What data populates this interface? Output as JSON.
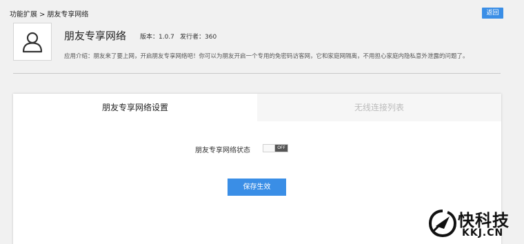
{
  "breadcrumb": {
    "parent": "功能扩展",
    "separator": ">",
    "current": "朋友专享网络"
  },
  "back_button": "返回",
  "app": {
    "icon": "user-silhouette-icon",
    "name": "朋友专享网络",
    "version": "版本：1.0.7",
    "publisher": "发行者：360",
    "description": "应用介绍：朋友来了要上网，开启朋友专享网络吧！你可以为朋友开启一个专用的免密码访客网，它和家庭网隔离，不用担心家庭内隐私意外泄露的问题了。"
  },
  "tabs": [
    {
      "label": "朋友专享网络设置",
      "active": true
    },
    {
      "label": "无线连接列表",
      "active": false
    }
  ],
  "settings": {
    "status_label": "朋友专享网络状态",
    "toggle_state": "OFF",
    "save_label": "保存生效"
  },
  "watermark": {
    "name": "快科技",
    "url": "KKJ.CN"
  },
  "colors": {
    "accent": "#3a8ee6",
    "background": "#f1f1f1",
    "panel": "#ffffff"
  }
}
